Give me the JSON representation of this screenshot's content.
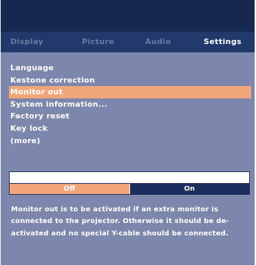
{
  "tabs": [
    {
      "label": "Display",
      "active": false
    },
    {
      "label": "Picture",
      "active": false
    },
    {
      "label": "Audio",
      "active": false
    },
    {
      "label": "Settings",
      "active": true
    }
  ],
  "menu": {
    "items": [
      "Language",
      "Kestone correction",
      "Monitor out",
      "System information...",
      "Factory reset",
      "Key lock",
      "(more)"
    ],
    "selected_index": 2
  },
  "toggle": {
    "off_label": "Off",
    "on_label": "On",
    "selected": "Off"
  },
  "description": "Monitor out is to be activated if an extra monitor is connected to the projector. Otherwise it should be de-activated and no special Y-cable should be connected.",
  "colors": {
    "header": "#142850",
    "tabbar": "#21386a",
    "panel": "#7d87ab",
    "highlight": "#f0a57a",
    "toggle_on": "#1c2d5e",
    "inactive_tab_text": "#6c7aa3"
  }
}
